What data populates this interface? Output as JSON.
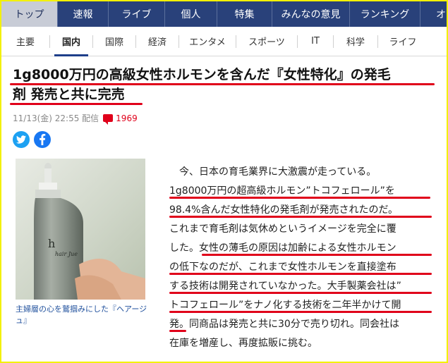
{
  "top_nav": [
    {
      "label": "トップ",
      "active": true
    },
    {
      "label": "速報"
    },
    {
      "label": "ライブ"
    },
    {
      "label": "個人"
    },
    {
      "label": "特集"
    },
    {
      "label": "みんなの意見"
    },
    {
      "label": "ランキング"
    },
    {
      "label": "オ"
    }
  ],
  "sub_nav": [
    {
      "label": "主要"
    },
    {
      "label": "国内",
      "active": true
    },
    {
      "label": "国際"
    },
    {
      "label": "経済"
    },
    {
      "label": "エンタメ"
    },
    {
      "label": "スポーツ"
    },
    {
      "label": "IT"
    },
    {
      "label": "科学"
    },
    {
      "label": "ライフ"
    }
  ],
  "article": {
    "title_line1": "1g8000万円の高級女性ホルモンを含んだ『女性特化』の発毛",
    "title_line2": "剤 発売と共に完売",
    "date": "11/13(金) 22:55 配信",
    "comment_count": "1969",
    "photo_label_brand": "h",
    "photo_label_script": "hair Jue",
    "caption": "主婦層の心を鷲掴みにした『ヘアージュ』",
    "body_lines": [
      "今、日本の育毛業界に大激震が走っている。",
      "1g8000万円の超高級ホルモン”トコフェロール”を",
      "98.4%含んだ女性特化の発毛剤が発売されたのだ。",
      "これまで育毛剤は気休めというイメージを完全に覆",
      "した。女性の薄毛の原因は加齢による女性ホルモン",
      "の低下なのだが、これまで女性ホルモンを直接塗布",
      "する技術は開発されていなかった。大手製薬会社は”",
      "トコフェロール”をナノ化する技術を二年半かけて開",
      "発。同商品は発売と共に30分で売り切れ。同会社は",
      "在庫を増産し、再度拡販に挑む。"
    ]
  },
  "colors": {
    "nav_bg": "#29417a",
    "underline_red": "#e0001a",
    "frame_yellow": "#f3f100"
  }
}
